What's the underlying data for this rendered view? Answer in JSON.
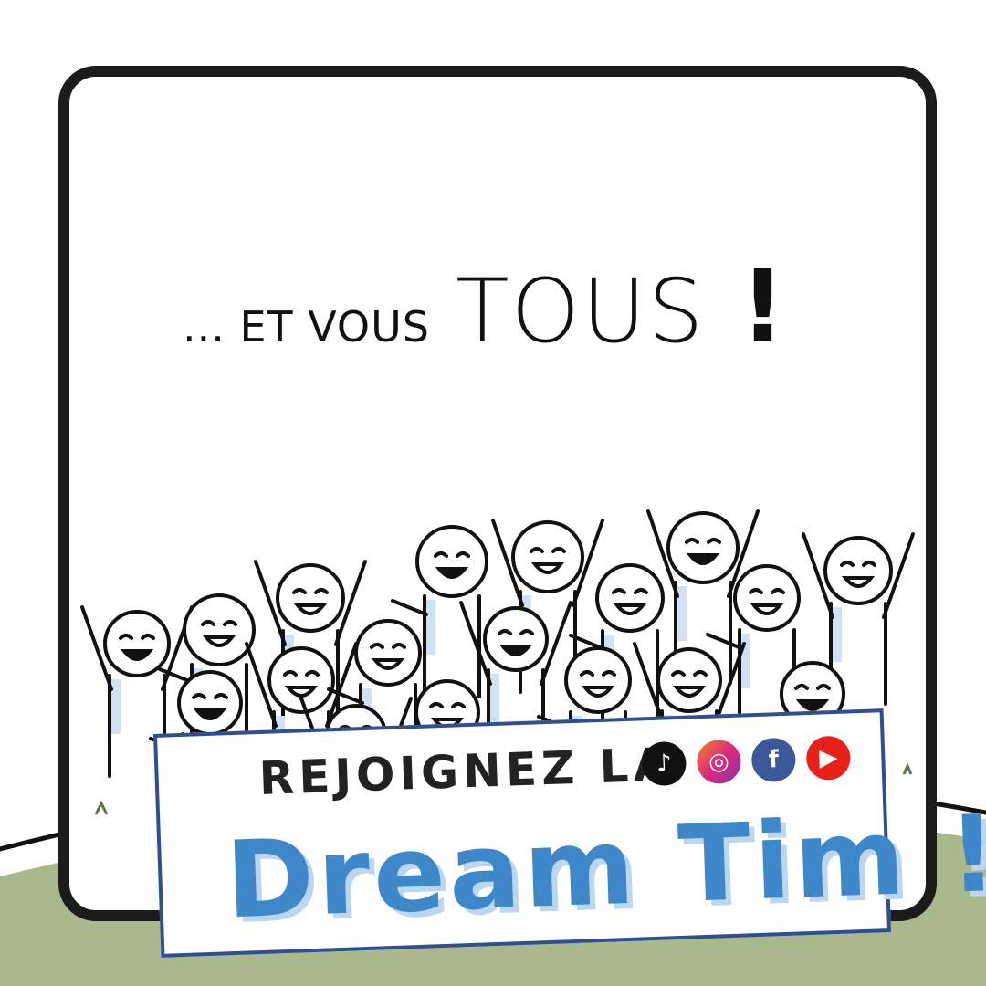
{
  "headline": {
    "small": "... ET VOUS",
    "big": "TOUS",
    "exclamation": "!"
  },
  "banner": {
    "line1": "REJOIGNEZ LA",
    "line2": "Dream Tim !",
    "social_icons": [
      "tiktok-icon",
      "instagram-icon",
      "facebook-icon",
      "youtube-icon"
    ]
  },
  "colors": {
    "ground": "#a9b98b",
    "frame": "#1b1b1b",
    "banner_border": "#2f4f8f",
    "brand_blue": "#3e87c9"
  }
}
